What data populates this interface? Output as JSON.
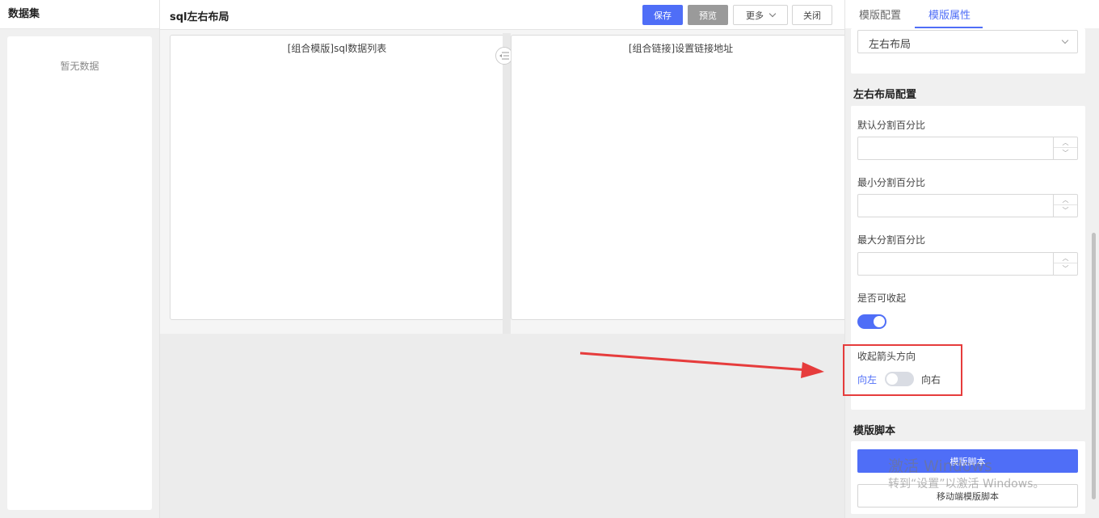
{
  "left_panel": {
    "title": "数据集",
    "empty_text": "暂无数据"
  },
  "header": {
    "title": "sql左右布局",
    "save_label": "保存",
    "preview_label": "预览",
    "more_label": "更多",
    "close_label": "关闭"
  },
  "canvas": {
    "left_pane_label": "[组合模版]sql数据列表",
    "right_pane_label": "[组合链接]设置链接地址"
  },
  "right_panel": {
    "tabs": [
      {
        "label": "模版配置",
        "active": false
      },
      {
        "label": "模版属性",
        "active": true
      }
    ],
    "layout_select_value": "左右布局",
    "layout_section_title": "左右布局配置",
    "fields": {
      "default_split_label": "默认分割百分比",
      "min_split_label": "最小分割百分比",
      "max_split_label": "最大分割百分比",
      "collapsible_label": "是否可收起",
      "collapsible_on": true,
      "arrow_direction_label": "收起箭头方向",
      "direction_left_label": "向左",
      "direction_right_label": "向右"
    },
    "script_section_title": "模版脚本",
    "script_button_label": "模版脚本",
    "mobile_script_button_label": "移动端模版脚本"
  },
  "watermark": {
    "line1": "激活 Windows",
    "line2": "转到“设置”以激活 Windows。"
  },
  "colors": {
    "accent": "#4f6ef7",
    "highlight": "#e63c3c"
  }
}
